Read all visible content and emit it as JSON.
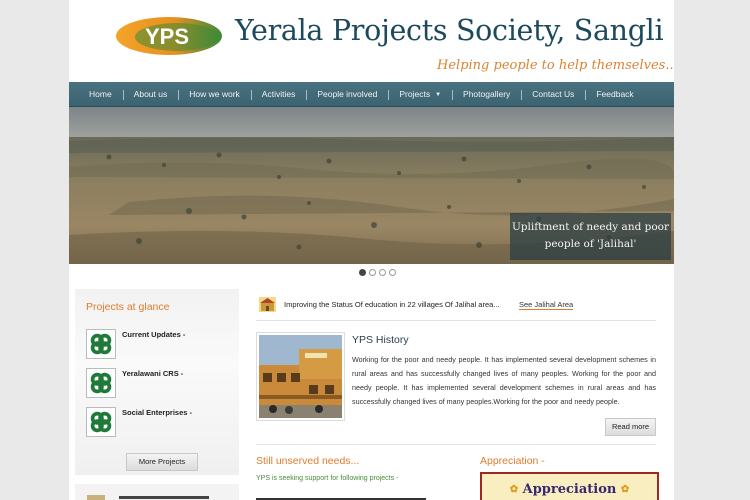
{
  "header": {
    "logo_text": "YPS",
    "title": "Yerala Projects Society, Sangli",
    "tagline": "Helping people to help themselves..."
  },
  "nav": {
    "items": [
      {
        "label": "Home"
      },
      {
        "label": "About us"
      },
      {
        "label": "How we work"
      },
      {
        "label": "Activities"
      },
      {
        "label": "People involved"
      },
      {
        "label": "Projects",
        "has_dropdown": true
      },
      {
        "label": "Photogallery"
      },
      {
        "label": "Contact Us"
      },
      {
        "label": "Feedback"
      }
    ]
  },
  "slider": {
    "caption": "Upliftment of needy and poor people of 'Jalihal'",
    "slide_count": 4,
    "active_slide": 1
  },
  "projects_panel": {
    "title": "Projects at glance",
    "items": [
      {
        "label": "Current Updates -"
      },
      {
        "label": "Yeralawani CRS -"
      },
      {
        "label": "Social Enterprises -"
      }
    ],
    "more_button": "More Projects"
  },
  "ticker": {
    "text": "Improving the Status Of education in 22 villages Of Jalihal area...",
    "link": "See Jalihal Area"
  },
  "history": {
    "title": "YPS History",
    "body": "Working for the poor and needy people. It has implemented several development schemes in rural areas and has successfully changed lives of many peoples. Working for the poor and needy people. It has implemented several development schemes in rural areas and has successfully changed lives of many peoples.Working for the poor and needy people.",
    "read_more": "Read more"
  },
  "needs": {
    "title": "Still unserved needs...",
    "text": "YPS is seeking support for following projects -"
  },
  "appreciation": {
    "title": "Appreciation -",
    "banner_text": "Appreciation"
  },
  "colors": {
    "nav_bg": "#3f6876",
    "accent_orange": "#e07b2b",
    "title_blue": "#1c4a5c",
    "green_link": "#4a8a3a",
    "appreciation_border": "#9c2a23"
  }
}
